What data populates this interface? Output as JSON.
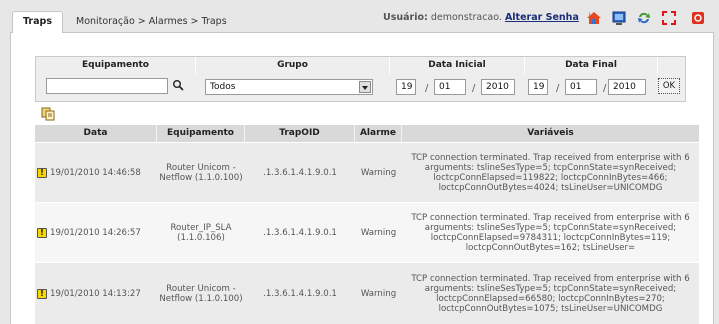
{
  "tabs": {
    "active": "Traps"
  },
  "breadcrumb": "Monitoração > Alarmes > Traps",
  "user": {
    "label": "Usuário:",
    "name": "demonstracao.",
    "change_password": "Alterar Senha",
    "separator": "|"
  },
  "toolbar_icons": [
    "home-icon",
    "monitor-icon",
    "refresh-icon",
    "fullscreen-icon",
    "close-icon"
  ],
  "filter": {
    "headers": {
      "equipment": "Equipamento",
      "group": "Grupo",
      "start_date": "Data Inicial",
      "end_date": "Data Final"
    },
    "equipment_value": "",
    "group_value": "Todos",
    "start": {
      "day": "19",
      "month": "01",
      "year": "2010"
    },
    "end": {
      "day": "19",
      "month": "01",
      "year": "2010"
    },
    "ok_label": "OK"
  },
  "table": {
    "headers": {
      "date": "Data",
      "equipment": "Equipamento",
      "trapoid": "TrapOID",
      "alarm": "Alarme",
      "vars": "Variáveis"
    },
    "rows": [
      {
        "date": "19/01/2010 14:46:58",
        "equipment": "Router Unicom - Netflow (1.1.0.100)",
        "trapoid": ".1.3.6.1.4.1.9.0.1",
        "alarm": "Warning",
        "vars": "TCP connection terminated. Trap received from enterprise with 6 arguments: tslineSesType=5; tcpConnState=synReceived; loctcpConnElapsed=119822; loctcpConnInBytes=466; loctcpConnOutBytes=4024; tsLineUser=UNICOMDG"
      },
      {
        "date": "19/01/2010 14:26:57",
        "equipment": "Router_IP_SLA (1.1.0.106)",
        "trapoid": ".1.3.6.1.4.1.9.0.1",
        "alarm": "Warning",
        "vars": "TCP connection terminated. Trap received from enterprise with 6 arguments: tslineSesType=5; tcpConnState=synReceived; loctcpConnElapsed=9784311; loctcpConnInBytes=119; loctcpConnOutBytes=162; tsLineUser="
      },
      {
        "date": "19/01/2010 14:13:27",
        "equipment": "Router Unicom - Netflow (1.1.0.100)",
        "trapoid": ".1.3.6.1.4.1.9.0.1",
        "alarm": "Warning",
        "vars": "TCP connection terminated. Trap received from enterprise with 6 arguments: tslineSesType=5; tcpConnState=synReceived; loctcpConnElapsed=66580; loctcpConnInBytes=270; loctcpConnOutBytes=1075; tsLineUser=UNICOMDG"
      }
    ]
  },
  "colors": {
    "link": "#1a2d7a",
    "warning": "#f6d700",
    "header_bg": "#d9d9d9"
  }
}
